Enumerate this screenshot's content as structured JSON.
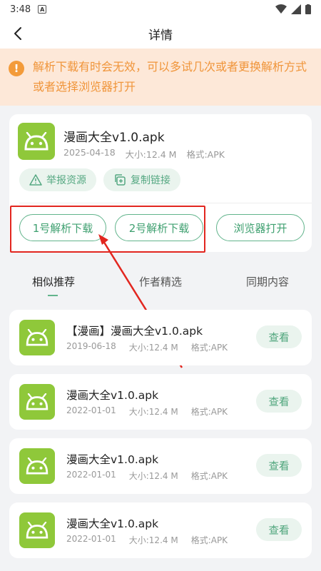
{
  "status": {
    "time": "3:48",
    "notif_glyph": "A"
  },
  "header": {
    "title": "详情"
  },
  "notice": {
    "text": "解析下载有时会无效，可以多试几次或者更换解析方式或者选择浏览器打开"
  },
  "detail": {
    "name": "漫画大全v1.0.apk",
    "date": "2025-04-18",
    "size": "大小:12.4 M",
    "format": "格式:APK",
    "report_label": "举报资源",
    "copy_label": "复制链接",
    "download1_label": "1号解析下载",
    "download2_label": "2号解析下载",
    "browser_label": "浏览器打开"
  },
  "tabs": [
    {
      "label": "相似推荐"
    },
    {
      "label": "作者精选"
    },
    {
      "label": "同期内容"
    }
  ],
  "items": [
    {
      "name": "【漫画】漫画大全v1.0.apk",
      "date": "2019-06-18",
      "size": "大小:12.4 M",
      "format": "格式:APK",
      "action": "查看"
    },
    {
      "name": "漫画大全v1.0.apk",
      "date": "2022-01-01",
      "size": "大小:12.4 M",
      "format": "格式:APK",
      "action": "查看"
    },
    {
      "name": "漫画大全v1.0.apk",
      "date": "2022-01-01",
      "size": "大小:12.4 M",
      "format": "格式:APK",
      "action": "查看"
    },
    {
      "name": "漫画大全v1.0.apk",
      "date": "2022-01-01",
      "size": "大小:12.4 M",
      "format": "格式:APK",
      "action": "查看"
    }
  ],
  "colors": {
    "accent": "#62b48c",
    "apk_icon": "#8fc83a",
    "notice_bg": "#fde8d8",
    "notice_text": "#f0953a",
    "highlight": "#e2261f"
  }
}
